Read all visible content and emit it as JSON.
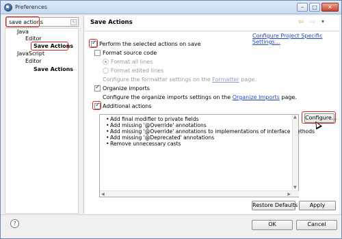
{
  "window": {
    "title": "Preferences",
    "controls": {
      "minimize": "–",
      "maximize": "□",
      "close": "✕"
    }
  },
  "filter": {
    "value": "save actions",
    "clear_icon": "✎"
  },
  "tree": [
    {
      "label": "Java",
      "bold": false
    },
    {
      "label": "Editor",
      "bold": false
    },
    {
      "label": "Save Actions",
      "bold": true
    },
    {
      "label": "JavaScript",
      "bold": false
    },
    {
      "label": "Editor",
      "bold": false
    },
    {
      "label": "Save Actions",
      "bold": true
    }
  ],
  "panel": {
    "title": "Save Actions",
    "nav": {
      "back": "⇦",
      "forward": "⇨",
      "menu": "▾"
    },
    "config_link": "Configure Project Specific Settings...",
    "perform_label": "Perform the selected actions on save",
    "format_label": "Format source code",
    "format_all": "Format all lines",
    "format_edited": "Format edited lines",
    "formatter_desc_before": "Configure the formatter settings on the ",
    "formatter_link": "Formatter",
    "formatter_desc_after": " page.",
    "organize_label": "Organize imports",
    "organize_desc_before": "Configure the organize imports settings on the ",
    "organize_link": "Organize Imports",
    "organize_desc_after": " page.",
    "additional_label": "Additional actions",
    "actions": [
      "Add final modifier to private fields",
      "Add missing '@Override' annotations",
      "Add missing '@Override' annotations to implementations of interface methods",
      "Add missing '@Deprecated' annotations",
      "Remove unnecessary casts"
    ],
    "configure_button": "Configure...",
    "restore_defaults": "Restore Defaults",
    "apply": "Apply"
  },
  "footer": {
    "help": "?",
    "ok": "OK",
    "cancel": "Cancel"
  },
  "colors": {
    "highlight": "#d9231c",
    "link": "#2046c8"
  }
}
